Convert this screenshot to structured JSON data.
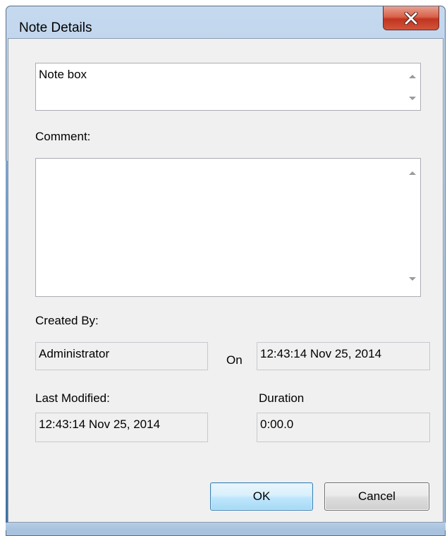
{
  "window": {
    "title": "Note Details"
  },
  "note": {
    "text": "Note box"
  },
  "comment": {
    "label": "Comment:",
    "text": ""
  },
  "created_by": {
    "label": "Created By:",
    "value": "Administrator",
    "on_label": "On",
    "on_value": "12:43:14 Nov 25, 2014"
  },
  "last_modified": {
    "label": "Last Modified:",
    "value": "12:43:14 Nov 25, 2014"
  },
  "duration": {
    "label": "Duration",
    "value": "0:00.0"
  },
  "buttons": {
    "ok": "OK",
    "cancel": "Cancel"
  },
  "icons": {
    "close": "close-icon",
    "scroll_up": "scroll-up-arrow-icon",
    "scroll_down": "scroll-down-arrow-icon"
  },
  "colors": {
    "title_bar": "#b3cbe5",
    "close_button": "#d9614b",
    "dialog_background": "#f0f0f0",
    "default_button": "#bee6fd"
  }
}
